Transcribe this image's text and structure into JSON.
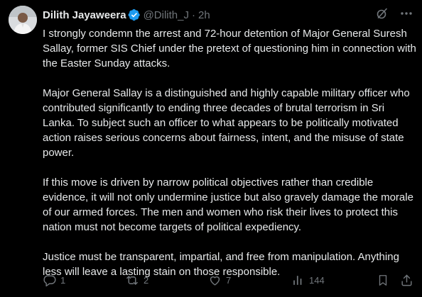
{
  "author": {
    "name": "Dilith Jayaweera",
    "handle": "@Dilith_J",
    "separator": "·",
    "time": "2h"
  },
  "tweet": {
    "paragraphs": [
      "I strongly condemn the arrest and 72-hour detention of Major General Suresh Sallay, former SIS Chief under the pretext of questioning him in connection with the Easter Sunday attacks.",
      "Major General Sallay is a distinguished and highly capable military officer who contributed significantly to ending three decades of brutal terrorism in Sri Lanka. To subject such an officer to what appears to be politically motivated action raises serious concerns about fairness, intent, and the misuse of state power.",
      "If this move is driven by narrow political objectives rather than credible evidence, it will not only undermine justice but also gravely damage the morale of our armed forces. The men and women who risk their lives to protect this nation must not become targets of political expediency.",
      "Justice must be transparent, impartial, and free from manipulation. Anything less will leave a lasting stain on those responsible."
    ]
  },
  "actions": {
    "replies": "1",
    "reposts": "2",
    "likes": "7",
    "views": "144"
  },
  "icons": {
    "verified": "verified-badge-icon",
    "grok": "grok-icon",
    "more": "more-icon",
    "reply": "reply-icon",
    "repost": "repost-icon",
    "like": "like-icon",
    "views": "views-icon",
    "bookmark": "bookmark-icon",
    "share": "share-icon"
  },
  "colors": {
    "background": "#000000",
    "text": "#e7e9ea",
    "secondary": "#71767b",
    "verified": "#1d9bf0"
  }
}
